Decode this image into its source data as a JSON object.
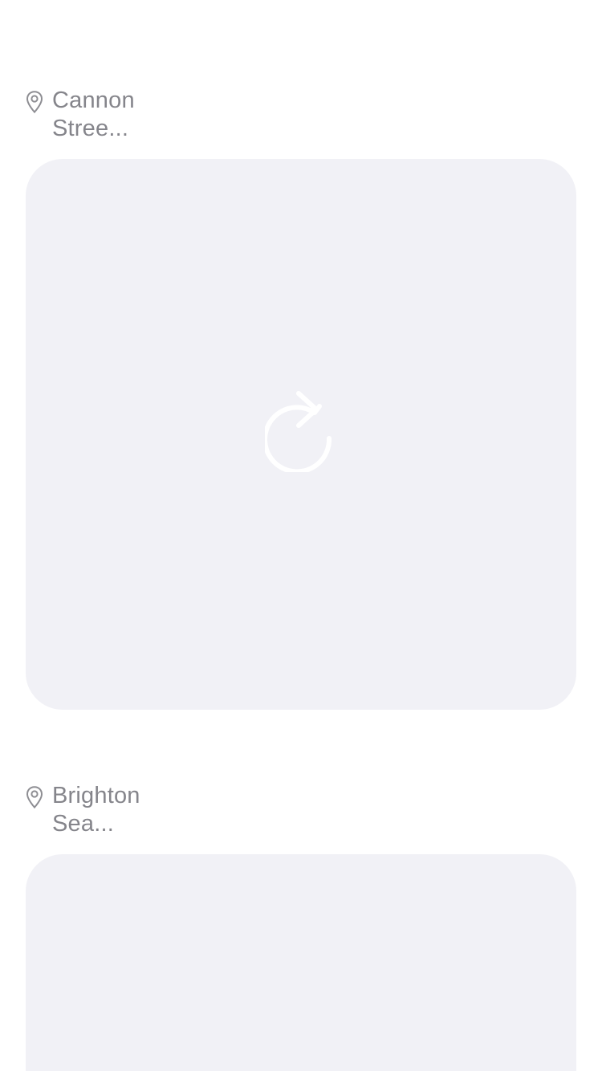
{
  "feed": {
    "items": [
      {
        "location": "Cannon Stree...",
        "location_icon": "map-pin-icon",
        "status_icon": "reload-icon",
        "tile_color": "#f1f1f6"
      },
      {
        "location": "Brighton Sea...",
        "location_icon": "map-pin-icon",
        "tile_color": "#f1f1f6"
      }
    ]
  },
  "colors": {
    "background": "#ffffff",
    "label": "#85858b",
    "tile": "#f1f1f6",
    "icon_light": "#ffffff"
  }
}
